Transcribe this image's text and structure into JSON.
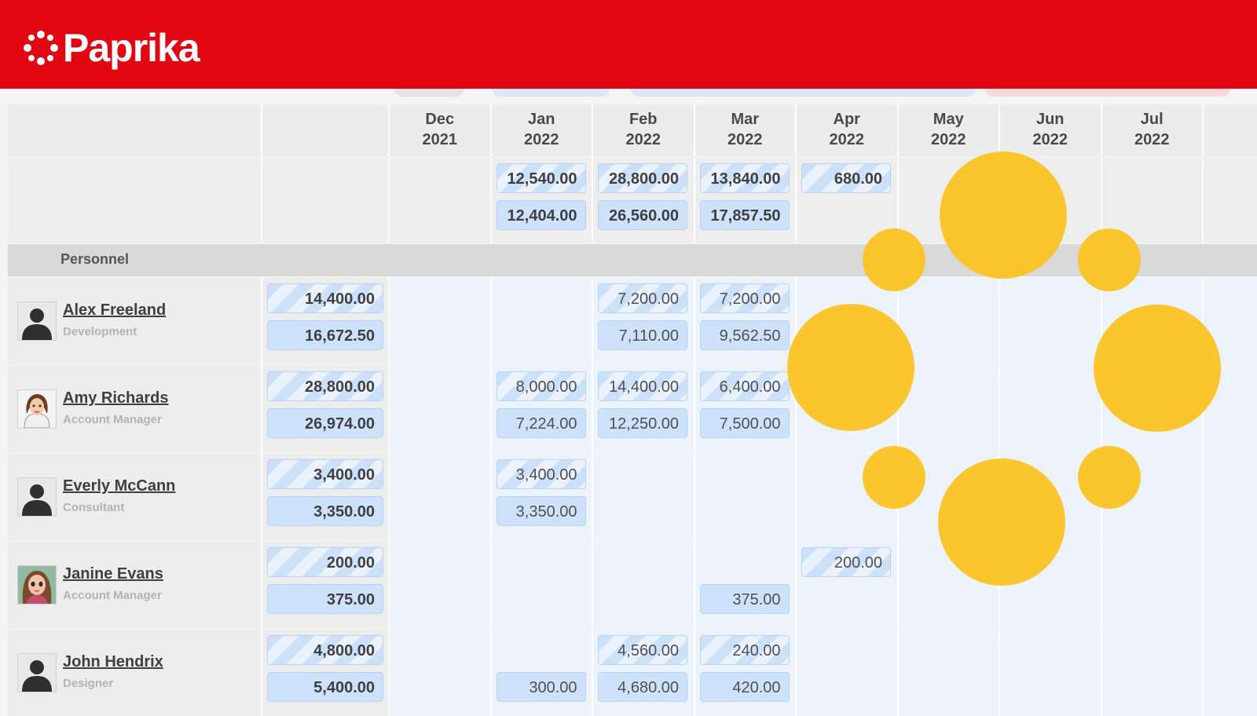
{
  "brand": {
    "name": "Paprika",
    "color": "#e10712"
  },
  "months": [
    {
      "month": "Dec",
      "year": "2021"
    },
    {
      "month": "Jan",
      "year": "2022"
    },
    {
      "month": "Feb",
      "year": "2022"
    },
    {
      "month": "Mar",
      "year": "2022"
    },
    {
      "month": "Apr",
      "year": "2022"
    },
    {
      "month": "May",
      "year": "2022"
    },
    {
      "month": "Jun",
      "year": "2022"
    },
    {
      "month": "Jul",
      "year": "2022"
    }
  ],
  "totals": {
    "planned": [
      "",
      "12,540.00",
      "28,800.00",
      "13,840.00",
      "680.00",
      "",
      "",
      ""
    ],
    "actual": [
      "",
      "12,404.00",
      "26,560.00",
      "17,857.50",
      "",
      "",
      "",
      ""
    ]
  },
  "section": {
    "label": "Personnel"
  },
  "people": [
    {
      "name": "Alex Freeland",
      "role": "Development",
      "avatar_icon": "default-user-icon",
      "total_planned": "14,400.00",
      "total_actual": "16,672.50",
      "planned": [
        "",
        "",
        "7,200.00",
        "7,200.00",
        "",
        "",
        "",
        ""
      ],
      "actual": [
        "",
        "",
        "7,110.00",
        "9,562.50",
        "",
        "",
        "",
        ""
      ]
    },
    {
      "name": "Amy Richards",
      "role": "Account Manager",
      "avatar_icon": "woman-avatar-icon",
      "total_planned": "28,800.00",
      "total_actual": "26,974.00",
      "planned": [
        "",
        "8,000.00",
        "14,400.00",
        "6,400.00",
        "",
        "",
        "",
        ""
      ],
      "actual": [
        "",
        "7,224.00",
        "12,250.00",
        "7,500.00",
        "",
        "",
        "",
        ""
      ]
    },
    {
      "name": "Everly McCann",
      "role": "Consultant",
      "avatar_icon": "default-user-icon",
      "total_planned": "3,400.00",
      "total_actual": "3,350.00",
      "planned": [
        "",
        "3,400.00",
        "",
        "",
        "",
        "",
        "",
        ""
      ],
      "actual": [
        "",
        "3,350.00",
        "",
        "",
        "",
        "",
        "",
        ""
      ]
    },
    {
      "name": "Janine Evans",
      "role": "Account Manager",
      "avatar_icon": "cartoon-avatar-icon",
      "total_planned": "200.00",
      "total_actual": "375.00",
      "planned": [
        "",
        "",
        "",
        "",
        "200.00",
        "",
        "",
        ""
      ],
      "actual": [
        "",
        "",
        "",
        "375.00",
        "",
        "",
        "",
        ""
      ]
    },
    {
      "name": "John Hendrix",
      "role": "Designer",
      "avatar_icon": "default-user-icon",
      "total_planned": "4,800.00",
      "total_actual": "5,400.00",
      "planned": [
        "",
        "",
        "4,560.00",
        "240.00",
        "",
        "",
        "",
        ""
      ],
      "actual": [
        "",
        "300.00",
        "4,680.00",
        "420.00",
        "",
        "",
        "",
        ""
      ]
    }
  ],
  "loading": {
    "icon": "loading-spinner-icon",
    "color": "#fbc326"
  }
}
